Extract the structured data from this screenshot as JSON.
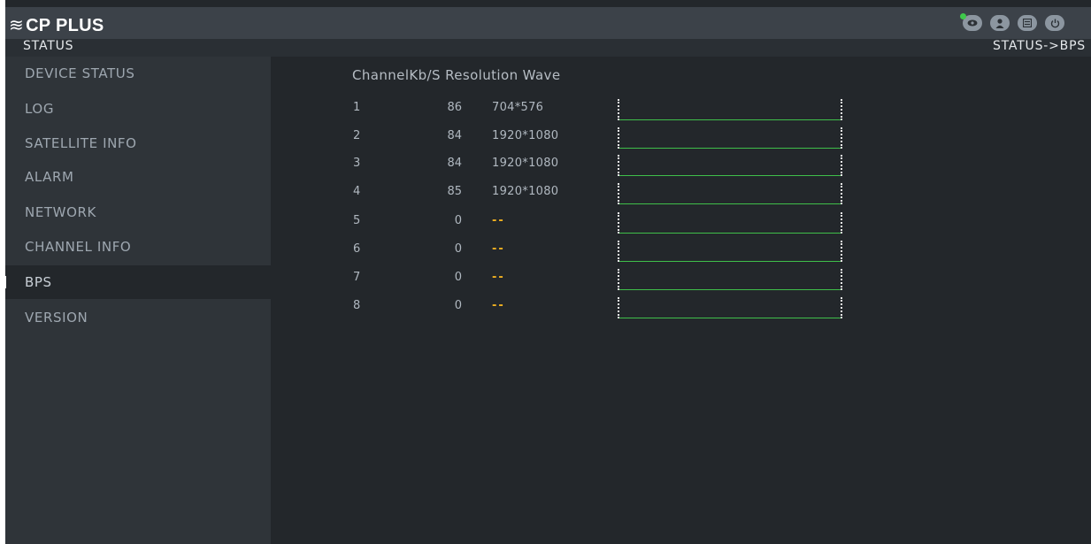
{
  "header": {
    "logo_mark": "≋",
    "logo_text": "CP PLUS",
    "icons": [
      "eye-icon",
      "user-icon",
      "storage-icon",
      "power-icon"
    ]
  },
  "statusbar": {
    "left": "STATUS",
    "right": "STATUS->BPS"
  },
  "sidebar": {
    "items": [
      {
        "label": "DEVICE STATUS"
      },
      {
        "label": "LOG"
      },
      {
        "label": "SATELLITE INFO"
      },
      {
        "label": "ALARM"
      },
      {
        "label": "NETWORK"
      },
      {
        "label": "CHANNEL INFO"
      },
      {
        "label": "BPS",
        "active": true
      },
      {
        "label": "VERSION"
      }
    ]
  },
  "table": {
    "headers": {
      "channel": "Channel",
      "kbs": "Kb/S",
      "resolution": "Resolution",
      "wave": "Wave"
    },
    "rows": [
      {
        "channel": "1",
        "kbs": "86",
        "resolution": "704*576"
      },
      {
        "channel": "2",
        "kbs": "84",
        "resolution": "1920*1080"
      },
      {
        "channel": "3",
        "kbs": "84",
        "resolution": "1920*1080"
      },
      {
        "channel": "4",
        "kbs": "85",
        "resolution": "1920*1080"
      },
      {
        "channel": "5",
        "kbs": "0",
        "resolution": "--"
      },
      {
        "channel": "6",
        "kbs": "0",
        "resolution": "--"
      },
      {
        "channel": "7",
        "kbs": "0",
        "resolution": "--"
      },
      {
        "channel": "8",
        "kbs": "0",
        "resolution": "--"
      }
    ]
  },
  "colors": {
    "wave_line": "#3fbf4a",
    "dash": "#f0b020",
    "status_online": "#3ec84a"
  }
}
